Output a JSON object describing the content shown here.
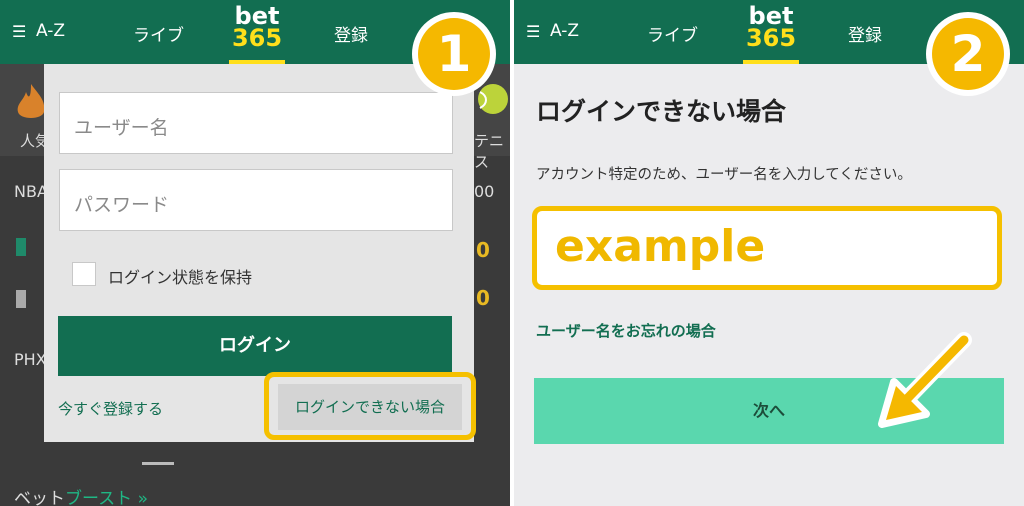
{
  "left": {
    "header": {
      "menu_icon": "menu-icon",
      "az": "A-Z",
      "live": "ライブ",
      "logo_top": "bet",
      "logo_bottom": "365",
      "register": "登録"
    },
    "step": "1",
    "background": {
      "popular": "人気",
      "tennis": "テニス",
      "nba": "NBA",
      "time": "00",
      "score1": "0",
      "score2": "0",
      "phx": "PHX",
      "bet_boost_prefix": "ベット",
      "bet_boost_accent": "ブースト",
      "bet_boost_chevron": "»"
    },
    "modal": {
      "username_placeholder": "ユーザー名",
      "password_placeholder": "パスワード",
      "remember_label": "ログイン状態を保持",
      "login_button": "ログイン",
      "signup_link": "今すぐ登録する",
      "forgot_link": "ログインできない場合"
    }
  },
  "right": {
    "header": {
      "menu_icon": "menu-icon",
      "az": "A-Z",
      "live": "ライブ",
      "logo_top": "bet",
      "logo_bottom": "365",
      "register": "登録"
    },
    "step": "2",
    "title": "ログインできない場合",
    "description": "アカウント特定のため、ユーザー名を入力してください。",
    "username_value": "example",
    "forgot_username": "ユーザー名をお忘れの場合",
    "next_button": "次へ"
  },
  "colors": {
    "brand_green": "#126e51",
    "accent_yellow": "#ffdf1b",
    "highlight": "#f5c000",
    "next_button": "#5ad7ae"
  }
}
